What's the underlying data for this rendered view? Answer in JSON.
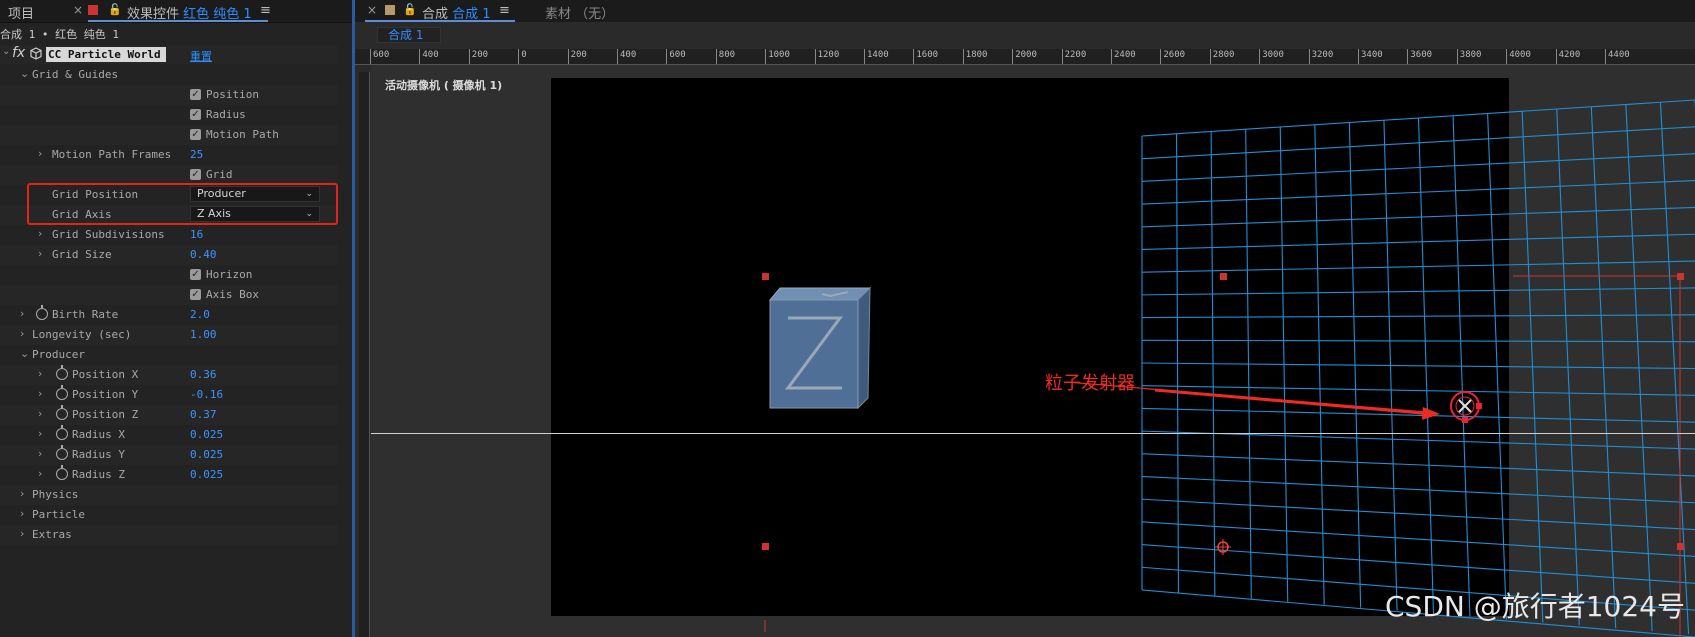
{
  "left_panel": {
    "tab_project": "项目",
    "tab_effects_prefix": "效果控件",
    "tab_effects_layer": "红色 纯色 1",
    "breadcrumb": "合成 1 • 红色 纯色 1",
    "effect_name": "CC Particle World",
    "effect_reset": "重置",
    "rows": {
      "grid_guides": "Grid & Guides",
      "position": "Position",
      "radius": "Radius",
      "motion_path": "Motion Path",
      "motion_path_frames": "Motion Path Frames",
      "motion_path_frames_val": "25",
      "grid": "Grid",
      "grid_position": "Grid Position",
      "grid_position_val": "Producer",
      "grid_axis": "Grid Axis",
      "grid_axis_val": "Z Axis",
      "grid_subdivisions": "Grid Subdivisions",
      "grid_subdivisions_val": "16",
      "grid_size": "Grid Size",
      "grid_size_val": "0.40",
      "horizon": "Horizon",
      "axis_box": "Axis Box",
      "birth_rate": "Birth Rate",
      "birth_rate_val": "2.0",
      "longevity": "Longevity (sec)",
      "longevity_val": "1.00",
      "producer": "Producer",
      "position_x": "Position X",
      "position_x_val": "0.36",
      "position_y": "Position Y",
      "position_y_val": "-0.16",
      "position_z": "Position Z",
      "position_z_val": "0.37",
      "radius_x": "Radius X",
      "radius_x_val": "0.025",
      "radius_y": "Radius Y",
      "radius_y_val": "0.025",
      "radius_z": "Radius Z",
      "radius_z_val": "0.025",
      "physics": "Physics",
      "particle": "Particle",
      "extras": "Extras"
    }
  },
  "right_panel": {
    "tab_comp_prefix": "合成",
    "tab_comp_name": "合成 1",
    "tab_footage": "素材 （无）",
    "sub_tab": "合成 1",
    "ruler_labels": [
      "600",
      "400",
      "200",
      "0",
      "200",
      "400",
      "600",
      "800",
      "1000",
      "1200",
      "1400",
      "1600",
      "1800",
      "2000",
      "2200",
      "2400",
      "2600",
      "2800",
      "3000",
      "3200",
      "3400",
      "3600",
      "3800",
      "4000",
      "4200",
      "4400"
    ],
    "camera_label": "活动摄像机 ( 摄像机 1)",
    "annotation": "粒子发射器",
    "watermark": "CSDN @旅行者1024号"
  },
  "colors": {
    "accent_blue": "#2f8dff",
    "highlight_red": "#e0261b",
    "grid_blue": "#1e8fd6",
    "handle_red": "#cc3333"
  }
}
